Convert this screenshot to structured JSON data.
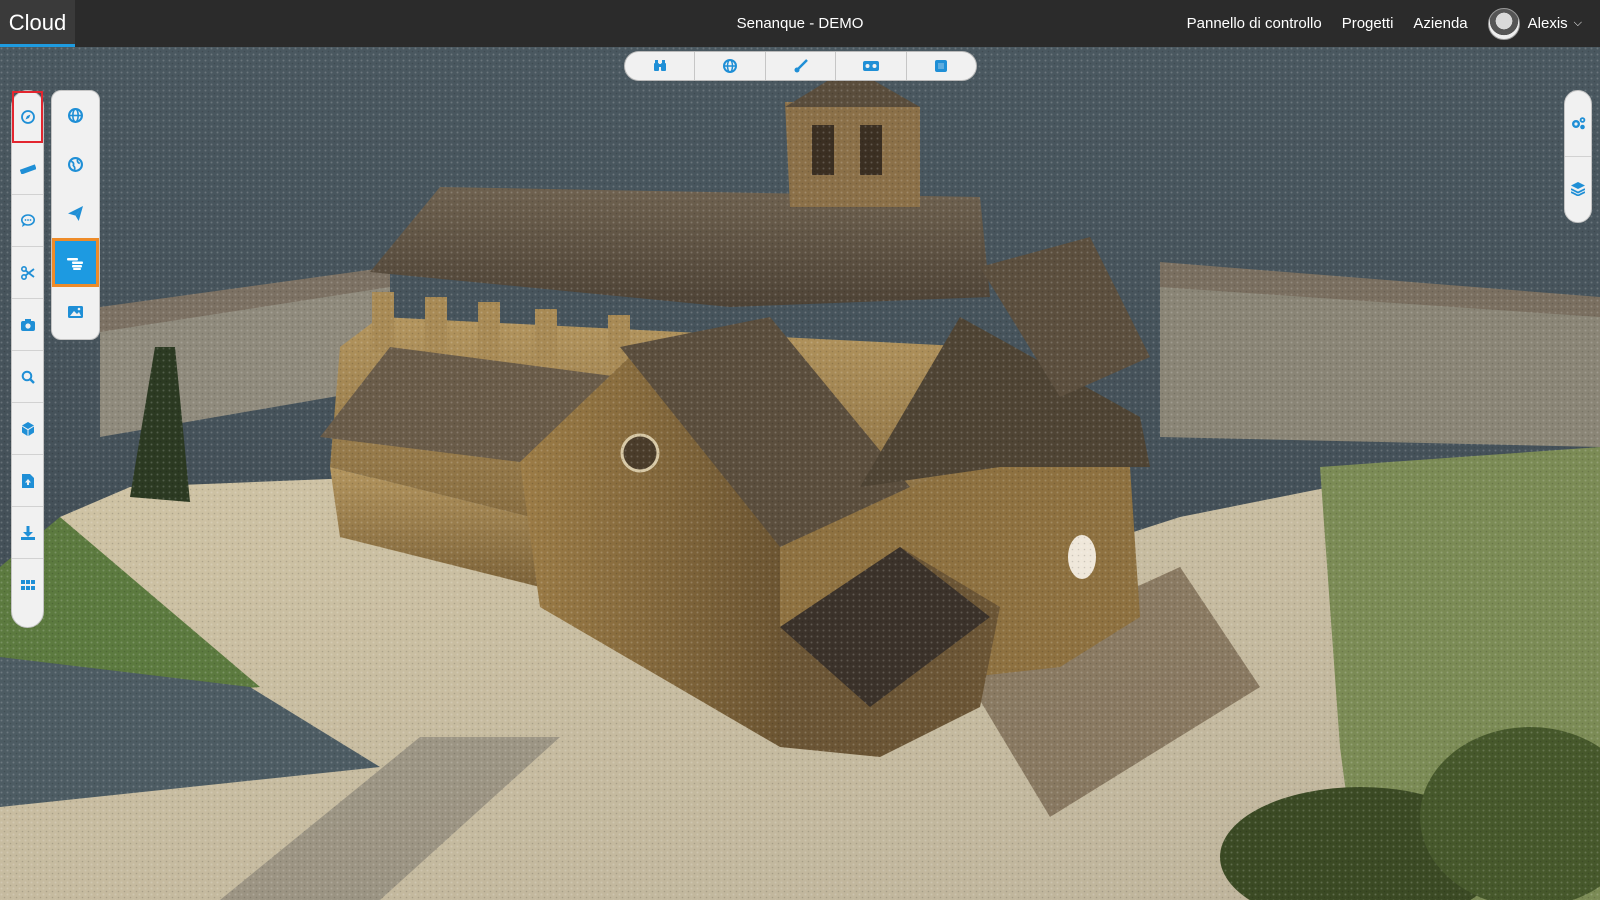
{
  "app": {
    "brand": "Cloud",
    "project_title": "Senanque - DEMO"
  },
  "nav": {
    "dashboard": "Pannello di controllo",
    "projects": "Progetti",
    "company": "Azienda",
    "user_name": "Alexis"
  },
  "colors": {
    "topbar": "#2b2b2b",
    "accent": "#1d9ae1",
    "active_outline": "#e3262f",
    "selected_border": "#ee8b28"
  },
  "top_toolbar": {
    "icons": [
      "binoculars-icon",
      "globe-icon",
      "brush-icon",
      "vr-headset-icon",
      "square-icon"
    ]
  },
  "left_toolbar": {
    "icons": [
      "compass-icon",
      "ruler-icon",
      "comment-icon",
      "scissors-icon",
      "camera-icon",
      "search-icon",
      "cube-icon",
      "file-upload-icon",
      "download-icon",
      "grid-icon"
    ],
    "selected": "compass-icon"
  },
  "navigation_submenu": {
    "icons": [
      "globe-icon",
      "earth-icon",
      "paper-plane-icon",
      "hand-pointer-icon",
      "image-icon"
    ],
    "selected": "hand-pointer-icon"
  },
  "right_toolbar": {
    "icons": [
      "settings-gears-icon",
      "layers-icon"
    ]
  },
  "viewport": {
    "content": "point-cloud-3d-scene"
  }
}
